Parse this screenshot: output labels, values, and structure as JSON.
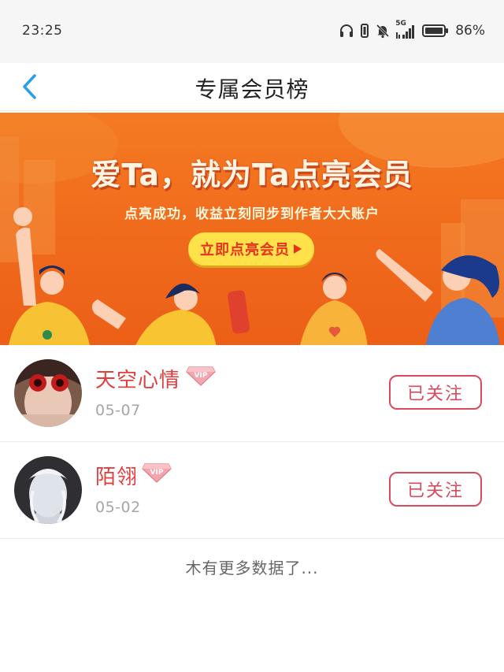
{
  "status_bar": {
    "time": "23:25",
    "network": "5G",
    "battery_percent": "86%",
    "icons": [
      "headphones-icon",
      "vibrate-icon",
      "mute-icon",
      "signal-icon",
      "battery-icon"
    ]
  },
  "header": {
    "title": "专属会员榜",
    "back_icon": "chevron-left-icon",
    "accent_color": "#2a9ee8"
  },
  "banner": {
    "headline": "爱Ta，就为Ta点亮会员",
    "subtitle": "点亮成功，收益立刻同步到作者大大账户",
    "cta_label": "立即点亮会员",
    "cta_icon": "triangle-right-icon"
  },
  "members": [
    {
      "name": "天空心情",
      "badge": "VIP",
      "date": "05-07",
      "follow_label": "已关注"
    },
    {
      "name": "陌翎",
      "badge": "VIP",
      "date": "05-02",
      "follow_label": "已关注"
    }
  ],
  "footer": {
    "no_more": "木有更多数据了..."
  },
  "colors": {
    "name_red": "#e23e3e",
    "follow_border": "#d94a5c",
    "banner_orange": "#f06a1c"
  }
}
